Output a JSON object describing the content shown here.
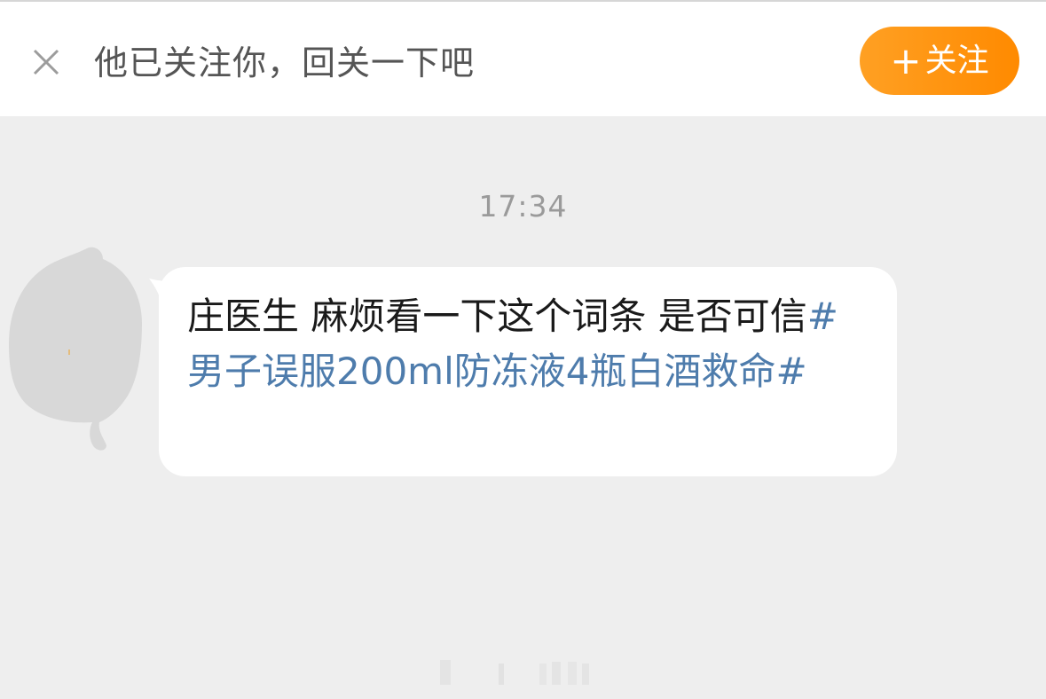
{
  "follow_bar": {
    "prompt": "他已关注你，回关一下吧",
    "follow_plus": "+",
    "follow_label": "关注"
  },
  "chat": {
    "timestamp": "17:34",
    "message": {
      "text": "庄医生 麻烦看一下这个词条 是否可信",
      "hashtag": "#男子误服200ml防冻液4瓶白酒救命#"
    }
  },
  "colors": {
    "accent_orange": "#ff9a1a",
    "hashtag_blue": "#4e7cac",
    "background": "#eeeeee"
  },
  "icons": {
    "close": "close-icon",
    "avatar": "avatar-placeholder"
  }
}
